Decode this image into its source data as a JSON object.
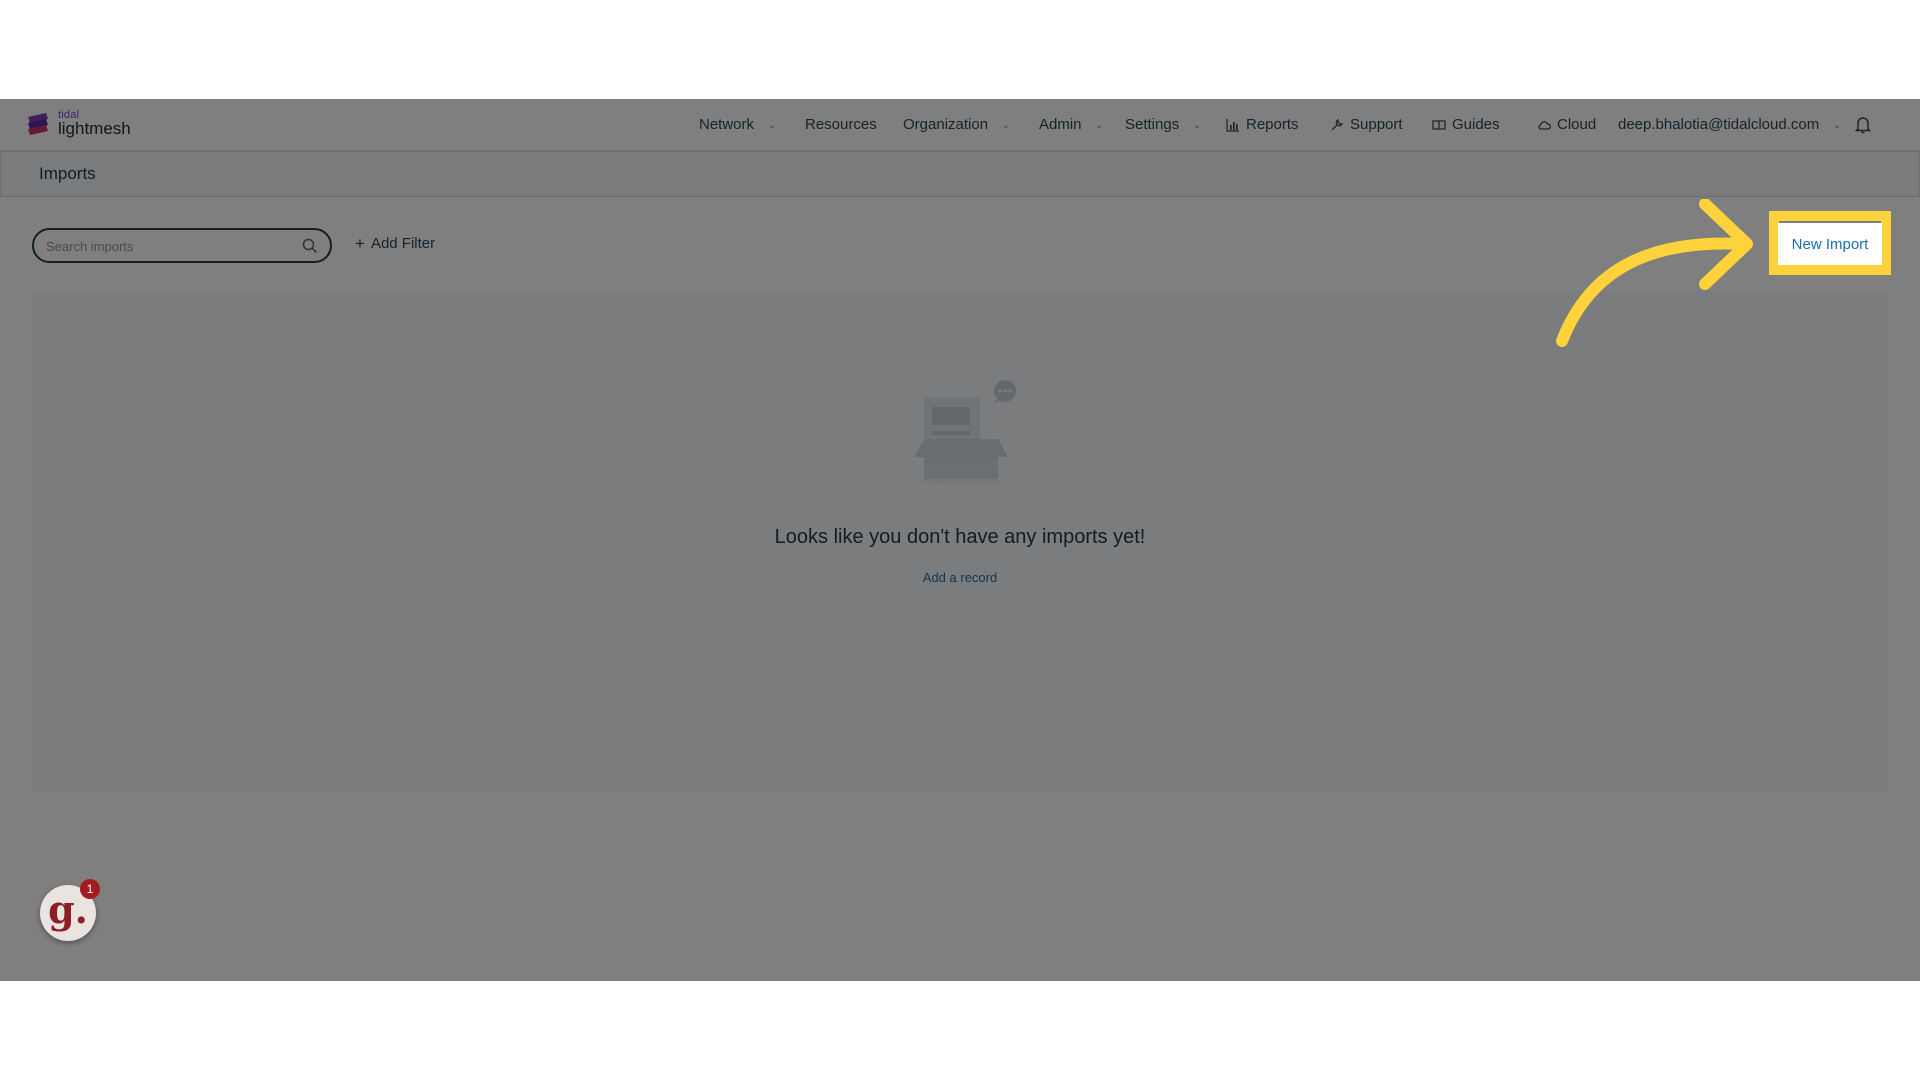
{
  "app": {
    "brand_small": "tidal",
    "brand": "lightmesh"
  },
  "nav": {
    "items": [
      {
        "label": "Network"
      },
      {
        "label": "Resources"
      },
      {
        "label": "Organization"
      },
      {
        "label": "Admin"
      },
      {
        "label": "Settings"
      },
      {
        "label": "Reports"
      },
      {
        "label": "Support"
      },
      {
        "label": "Guides"
      },
      {
        "label": "Cloud"
      }
    ],
    "user": "deep.bhalotia@tidalcloud.com"
  },
  "page": {
    "title": "Imports"
  },
  "toolbar": {
    "search_placeholder": "Search imports",
    "add_filter_label": "Add Filter",
    "new_import_label": "New Import"
  },
  "empty_state": {
    "title": "Looks like you don't have any imports yet!",
    "action_label": "Add a record"
  },
  "guide_widget": {
    "letter": "g.",
    "badge_count": "1"
  },
  "colors": {
    "highlight": "#fdd23a",
    "link": "#1a6fa8",
    "badge": "#a11b20"
  }
}
